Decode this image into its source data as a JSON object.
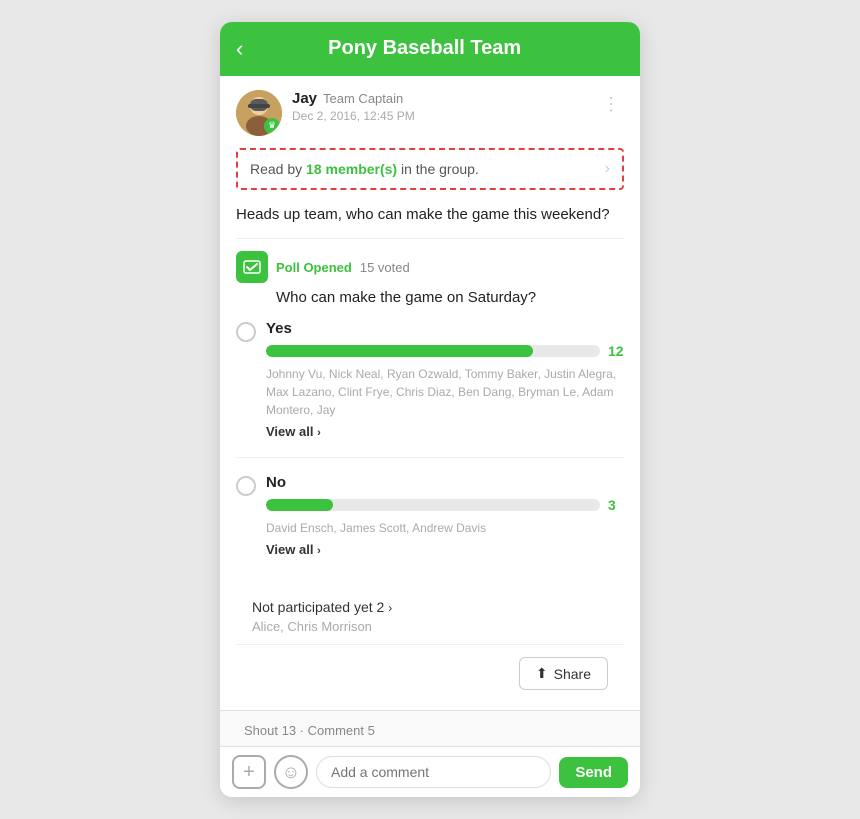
{
  "header": {
    "back_label": "‹",
    "title": "Pony Baseball Team"
  },
  "post": {
    "author": "Jay",
    "role": "Team Captain",
    "time": "Dec 2, 2016, 12:45 PM",
    "read_by_count": "18 member(s)",
    "read_by_suffix": " in the group.",
    "body": "Heads up team, who can make the game this weekend?",
    "menu_icon": "⋮"
  },
  "poll": {
    "status": "Poll Opened",
    "votes_label": "15 voted",
    "question": "Who can make the game on Saturday?",
    "options": [
      {
        "label": "Yes",
        "count": 12,
        "bar_percent": 80,
        "voters": "Johnny Vu, Nick Neal, Ryan Ozwald, Tommy Baker, Justin Alegra, Max Lazano, Clint Frye, Chris Diaz, Ben Dang, Bryman Le, Adam Montero, Jay",
        "view_all": "View all"
      },
      {
        "label": "No",
        "count": 3,
        "bar_percent": 20,
        "voters": "David Ensch, James Scott, Andrew Davis",
        "view_all": "View all"
      }
    ],
    "not_participated_label": "Not participated yet",
    "not_participated_count": "2",
    "not_participated_names": "Alice, Chris Morrison"
  },
  "share": {
    "button_label": "Share"
  },
  "footer": {
    "shout_label": "Shout 13",
    "separator": "·",
    "comment_label": "Comment 5"
  },
  "comment_bar": {
    "add_icon": "+",
    "emoji_icon": "☺",
    "placeholder": "Add a comment",
    "send_label": "Send"
  }
}
